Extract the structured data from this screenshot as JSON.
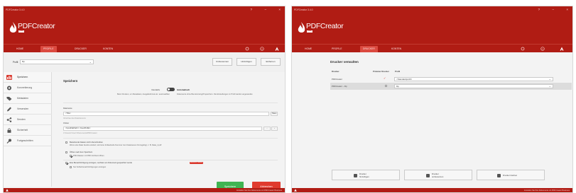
{
  "colors": {
    "brand": "#b01c14",
    "accent": "#d9372c",
    "active_tab": "#db4a40",
    "save_green": "#3fb452",
    "cancel_red": "#e03a2e"
  },
  "window1": {
    "title": "PDFCreator 3.4.0",
    "logo": {
      "name": "PDFCreator",
      "edition": "FREE"
    },
    "nav": {
      "home": "HOME",
      "profiles": "PROFILE",
      "printer": "DRUCKER",
      "accounts": "KONTEN"
    },
    "toolbar": {
      "label": "Profil:",
      "profile_value": "Dp",
      "rename_button": "Umbenennen",
      "add_button": "Hinzufügen",
      "delete_button": "Entfernen"
    },
    "sidebar": {
      "items": [
        {
          "label": "Speichern",
          "icon": "save-icon"
        },
        {
          "label": "Konvertierung",
          "icon": "convert-icon"
        },
        {
          "label": "Metadaten",
          "icon": "tag-icon"
        },
        {
          "label": "Versenden",
          "icon": "pen-icon"
        },
        {
          "label": "Senden",
          "icon": "share-icon"
        },
        {
          "label": "Sicherheit",
          "icon": "lock-icon"
        },
        {
          "label": "Fortgeschritten",
          "icon": "wrench-icon"
        }
      ]
    },
    "content": {
      "heading": "Speichern",
      "mode_left": "Interaktiv",
      "mode_right": "Automatisch",
      "mode_desc_left": "Beim Drucken, um Metadaten, Ausgabeformat etc. auszuwählen",
      "mode_desc_right": "Dokumente ohne Benutzereingriff speichern. Die Einstellungen im Profil werden angewendet.",
      "filename_label": "Dateiname",
      "filename_value": "<Title>",
      "filename_token_button": "Token",
      "filename_preview": "Vorschau des Dateinamens",
      "dir_label": "Ordner",
      "dir_value": "<InputFilePath>\\ <UserProfile>",
      "dir_browse": "...",
      "dir_preview": "C:\\Users\\<User>\\Documents\\PDFCreator",
      "option1_title": "Bestehende Dateien nicht überschreiben",
      "option1_desc": "Wenn eine Datei bereits existiert, wird eine fortlaufende Nummer zum Dateinamen hinzugefügt, z. B. Datei_2.pdf",
      "option2_title": "Öffnen nach dem Speichern",
      "option2_desc": "PDF-Dateien mit PDF Architect öffnen",
      "option3_title": "Eine Benachrichtigung anzeigen, nachdem ein Dokument gespeichert wurde",
      "option3_tag": "Business Feature",
      "option3_sub": "Nur Fehlerbenachrichtigungen anzeigen",
      "save_button": "Speichern",
      "cancel_button": "Abbrechen"
    },
    "status": "Erstellen Sie Ihre Dokumente mit PDFCreator Business"
  },
  "window2": {
    "title": "PDFCreator 3.4.0",
    "logo": {
      "name": "PDFCreator",
      "edition": "FREE"
    },
    "nav": {
      "home": "HOME",
      "profiles": "PROFILE",
      "printer": "DRUCKER",
      "accounts": "KONTEN"
    },
    "heading": "Drucker verwalten",
    "columns": {
      "printer": "Drucker",
      "primary": "Primärer Drucker",
      "profile": "Profil"
    },
    "rows": [
      {
        "printer": "PDFCreator",
        "primary": true,
        "profile": "<Standardprofil>"
      },
      {
        "printer": "PDFCreator – Dp",
        "primary": false,
        "profile": "Dp"
      }
    ],
    "buttons": {
      "add": "Drucker hinzufügen",
      "rename": "Drucker umbenennen",
      "delete": "Drucker löschen"
    },
    "status": "Erstellen Sie Ihre Dokumente mit PDFCreator Business"
  }
}
